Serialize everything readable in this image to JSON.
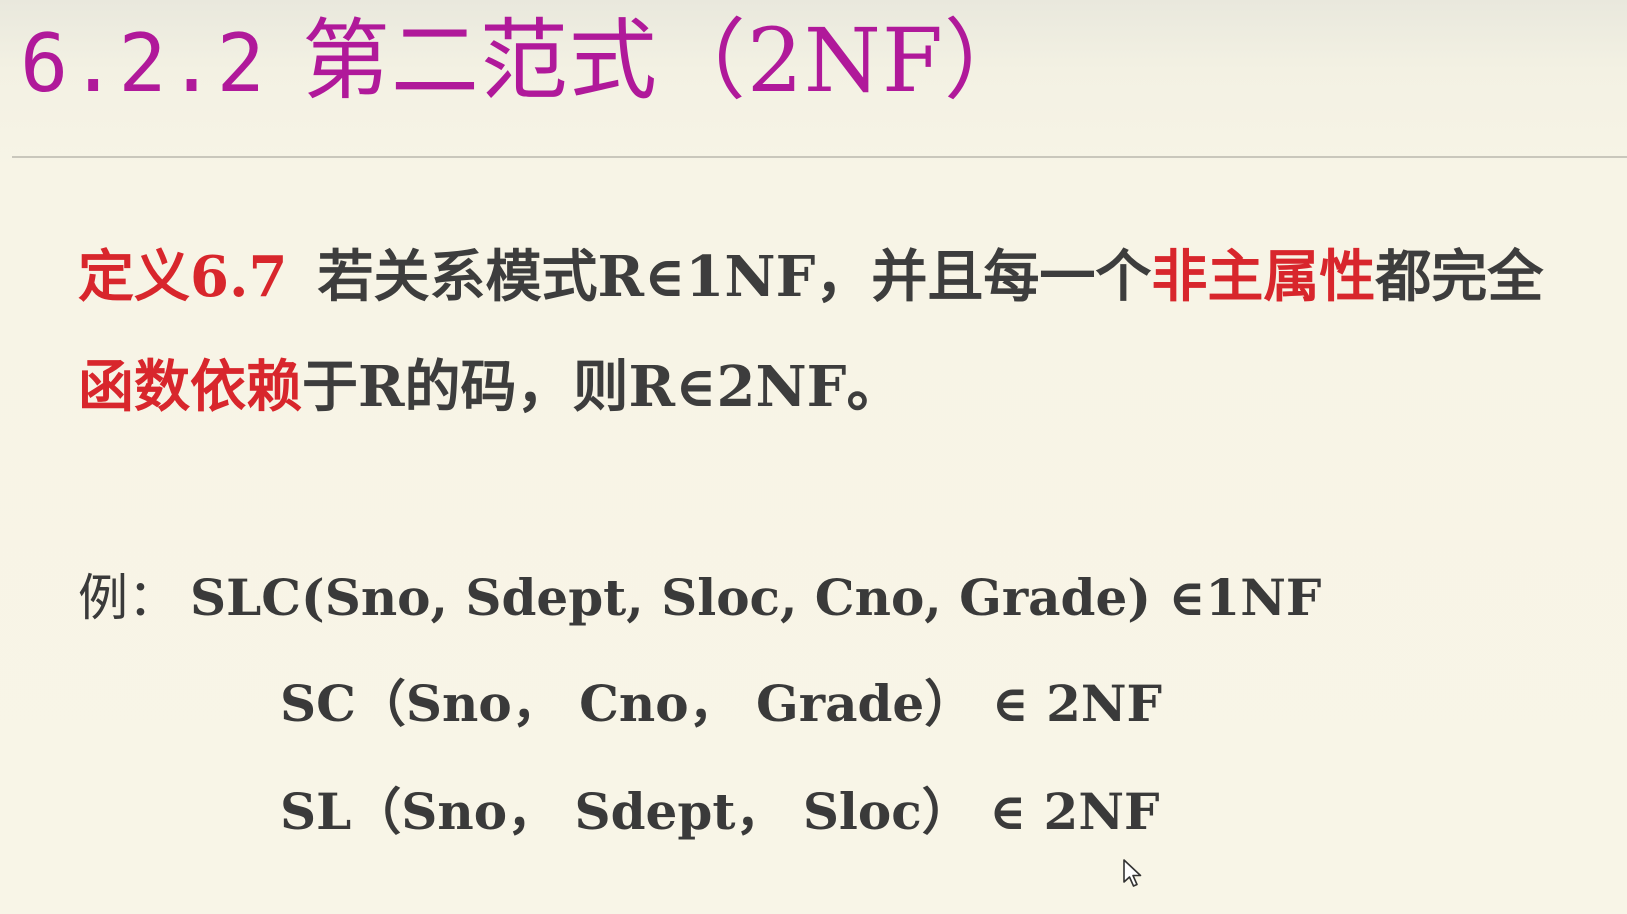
{
  "title": {
    "number": "6.2.2",
    "text": "第二范式（2NF）"
  },
  "definition": {
    "label": "定义6.7",
    "line1_text": "若关系模式R∈1NF，并且每一个",
    "line1_red": "非主属性",
    "line1_tail": "都完全",
    "line2_red": "函数依赖",
    "line2_text": "于R的码，则R∈2NF。"
  },
  "example": {
    "label": "例：",
    "line1": "SLC(Sno, Sdept, Sloc, Cno, Grade) ∈1NF",
    "line2": "SC（Sno， Cno， Grade） ∈ 2NF",
    "line3": "SL（Sno， Sdept， Sloc） ∈ 2NF"
  },
  "colors": {
    "title": "#b0199a",
    "highlight": "#d8262c",
    "body": "#3a3a3a",
    "background": "#f8f5e7"
  },
  "icons": {
    "cursor": "mouse-pointer-icon"
  }
}
